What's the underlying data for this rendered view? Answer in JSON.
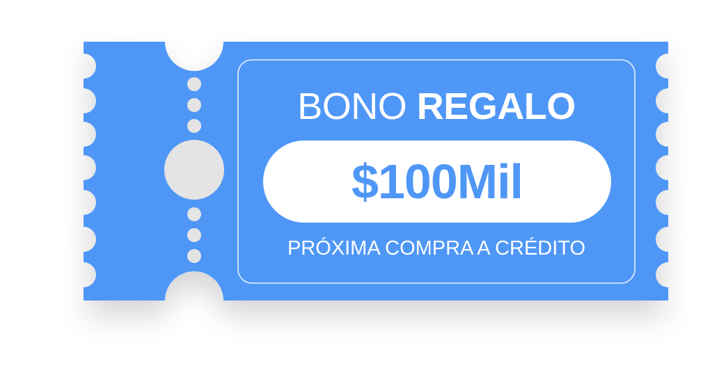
{
  "voucher": {
    "title_light": "BONO",
    "title_bold": "REGALO",
    "amount": "$100Mil",
    "subtitle": "PRÓXIMA COMPRA A CRÉDITO"
  },
  "colors": {
    "ticket": "#4f97f7",
    "notch": "#e4e4e4",
    "text": "#ffffff",
    "amount_text": "#4f97f7",
    "background": "#ffffff"
  }
}
